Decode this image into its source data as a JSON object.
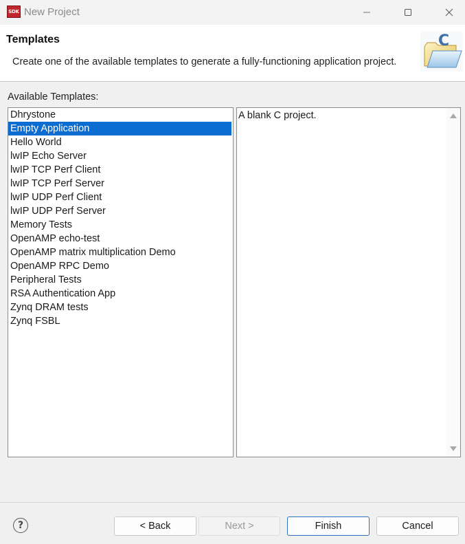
{
  "window": {
    "title": "New Project",
    "app_icon_text": "SDK",
    "minimize_icon": "minimize-icon",
    "maximize_icon": "maximize-icon",
    "close_icon": "close-icon"
  },
  "header": {
    "title": "Templates",
    "description": "Create one of the available templates to generate a fully-functioning application project.",
    "icon": "c-project-folder-icon"
  },
  "templates": {
    "label": "Available Templates:",
    "items": [
      {
        "label": "Dhrystone",
        "selected": false
      },
      {
        "label": "Empty Application",
        "selected": true
      },
      {
        "label": "Hello World",
        "selected": false
      },
      {
        "label": "lwIP Echo Server",
        "selected": false
      },
      {
        "label": "lwIP TCP Perf Client",
        "selected": false
      },
      {
        "label": "lwIP TCP Perf Server",
        "selected": false
      },
      {
        "label": "lwIP UDP Perf Client",
        "selected": false
      },
      {
        "label": "lwIP UDP Perf Server",
        "selected": false
      },
      {
        "label": "Memory Tests",
        "selected": false
      },
      {
        "label": "OpenAMP echo-test",
        "selected": false
      },
      {
        "label": "OpenAMP matrix multiplication Demo",
        "selected": false
      },
      {
        "label": "OpenAMP RPC Demo",
        "selected": false
      },
      {
        "label": "Peripheral Tests",
        "selected": false
      },
      {
        "label": "RSA Authentication App",
        "selected": false
      },
      {
        "label": "Zynq DRAM tests",
        "selected": false
      },
      {
        "label": "Zynq FSBL",
        "selected": false
      }
    ],
    "description": "A blank C project."
  },
  "footer": {
    "help_icon": "help-icon",
    "back_label": "< Back",
    "next_label": "Next >",
    "finish_label": "Finish",
    "cancel_label": "Cancel"
  },
  "colors": {
    "selection": "#0b6dd1",
    "header_bg": "#ffffff",
    "dialog_bg": "#f0f0f0"
  }
}
